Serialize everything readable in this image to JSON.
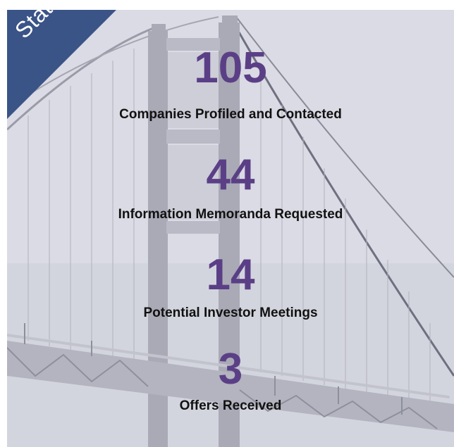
{
  "corner_tag": "Stats",
  "stats": [
    {
      "value": "105",
      "label": "Companies Profiled and Contacted"
    },
    {
      "value": "44",
      "label": "Information Memoranda Requested"
    },
    {
      "value": "14",
      "label": "Potential Investor Meetings"
    },
    {
      "value": "3",
      "label": "Offers Received"
    }
  ],
  "colors": {
    "accent": "#5b3f86",
    "ribbon": "#3b5487",
    "text": "#111111"
  },
  "background_image": "bridge-photo"
}
